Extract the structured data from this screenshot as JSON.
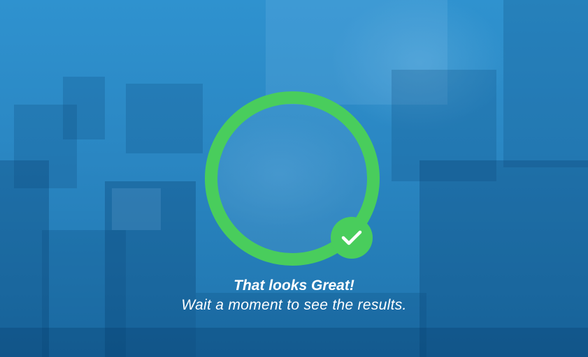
{
  "status": {
    "icon": "checkmark-icon",
    "ring_color": "#49cd5c",
    "title": "That looks Great!",
    "message": "Wait a moment to see the results."
  },
  "colors": {
    "overlay": "#2a8bc8",
    "success": "#49cd5c",
    "text": "#ffffff"
  }
}
